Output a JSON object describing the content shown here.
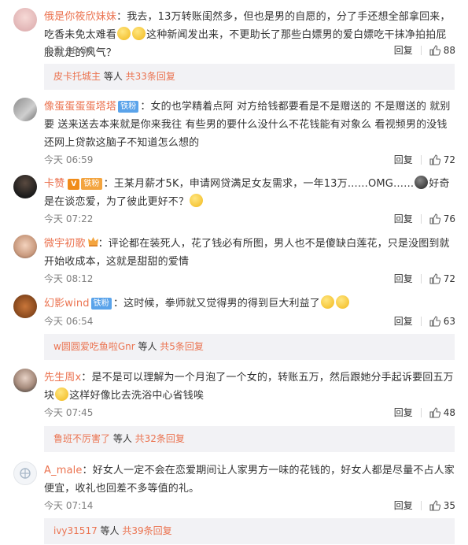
{
  "comments": [
    {
      "username": "俄是你筱欣妹妹",
      "text_a": "：我去，13万转账闺然多，但也是男的自愿的，分了手还想全部拿回来，吃香未免太难看",
      "text_b": "这种新闻发出来，不更助长了那些白嫖男的爱白嫖吃干抹净拍拍屁股就走的风气？",
      "time": "今天 08:06",
      "reply_label": "回复",
      "likes": "88",
      "sub": {
        "name": "皮卡托城主",
        "mid": " 等人 ",
        "count": "共33条回复"
      }
    },
    {
      "username": "像蛋蛋蛋蛋塔塔",
      "badge": "铁粉",
      "text": "：女的也学精着点阿 对方给钱都要看是不是赠送的 不是赠送的 就别要 送来送去本来就是你来我往 有些男的要什么没什么不花钱能有对象么  看视频男的没钱还网上贷款这脑子不知道怎么想的",
      "time": "今天 06:59",
      "reply_label": "回复",
      "likes": "72"
    },
    {
      "username": "卡赞",
      "vip": "V",
      "badge": "铁粉",
      "text_a": "：王某月薪才5K，申请网贷满足女友需求，一年13万……OMG……",
      "text_b": "好奇是在谈恋爱，为了彼此更好不？",
      "time": "今天 07:22",
      "reply_label": "回复",
      "likes": "76"
    },
    {
      "username": "微宇初歌",
      "text": "：评论都在装死人，花了钱必有所图，男人也不是傻缺白莲花，只是没图到就开始收成本，这就是甜甜的爱情",
      "time": "今天 08:12",
      "reply_label": "回复",
      "likes": "72"
    },
    {
      "username": "幻影wind",
      "badge": "铁粉",
      "text": "：这时候，拳师就又觉得男的得到巨大利益了",
      "time": "今天 06:54",
      "reply_label": "回复",
      "likes": "63",
      "sub": {
        "name": "w圆圆爱吃鱼啦Gnr",
        "mid": " 等人 ",
        "count": "共5条回复"
      }
    },
    {
      "username": "先生周x",
      "text_a": "：是不是可以理解为一个月泡了一个女的，转账五万，然后跟她分手起诉要回五万块",
      "text_b": "这样好像比去洗浴中心省钱唉",
      "time": "今天 07:45",
      "reply_label": "回复",
      "likes": "48",
      "sub": {
        "name": "鲁班不厉害了",
        "mid": " 等人 ",
        "count": "共32条回复"
      }
    },
    {
      "username": "A_male",
      "text_a": "：好女人一定不会在恋爱期间让人家男方一味的花钱的，好女人都是尽量不占人家便宜，收礼也回差不多等值的礼。",
      "time": "今天 07:14",
      "reply_label": "回复",
      "likes": "35",
      "sub": {
        "name": "ivy31517",
        "mid": " 等人 ",
        "count": "共39条回复"
      }
    }
  ],
  "colors": {
    "name": "#eb7350",
    "badge_fan": "#5aa3ea",
    "sub_bg": "#f2f2f5"
  }
}
